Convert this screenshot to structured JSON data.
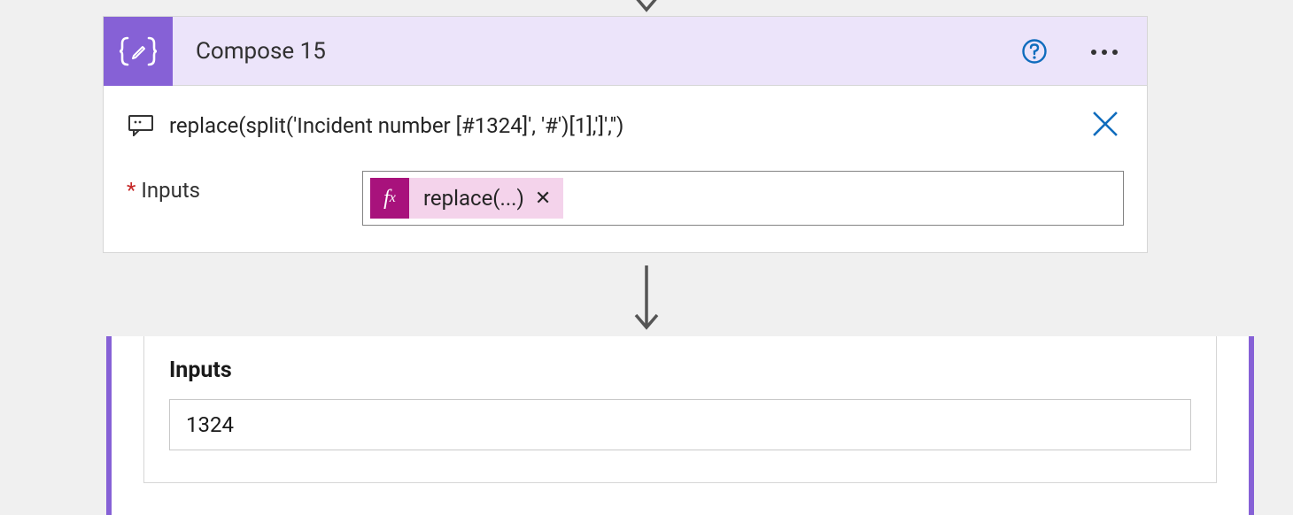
{
  "action": {
    "title": "Compose 15",
    "comment": "replace(split('Incident number [#1324]', '#')[1],']','')",
    "inputs_label": "Inputs",
    "token_label": "replace(...)"
  },
  "output": {
    "title": "Inputs",
    "value": "1324"
  }
}
